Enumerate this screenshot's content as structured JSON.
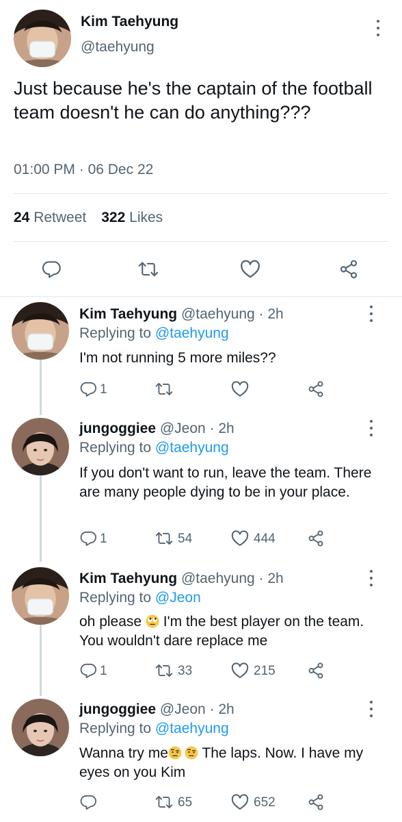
{
  "main_tweet": {
    "name": "Kim Taehyung",
    "handle": "@taehyung",
    "text": "Just because he's the captain of the football team doesn't he can do anything???",
    "time": "01:00 PM",
    "separator": "·",
    "date": "06 Dec 22",
    "retweets": "24",
    "retweets_label": "Retweet",
    "likes": "322",
    "likes_label": "Likes",
    "actions": [
      "reply-icon",
      "retweet-icon",
      "like-icon",
      "share-icon"
    ]
  },
  "replies": [
    {
      "name": "Kim Taehyung",
      "handle": "@taehyung",
      "age": "· 2h",
      "replying_prefix": "Replying to",
      "replying_to": "@taehyung",
      "text": "I'm not running 5 more miles??",
      "reply_count": "1",
      "retweet_count": "",
      "like_count": ""
    },
    {
      "name": "jungoggiee",
      "handle": "@Jeon",
      "age": "· 2h",
      "replying_prefix": "Replying to",
      "replying_to": "@taehyung",
      "text": "If you don't want to run, leave the team. There are many people dying to be in your place.",
      "reply_count": "1",
      "retweet_count": "54",
      "like_count": "444"
    },
    {
      "name": "Kim Taehyung",
      "handle": "@taehyung",
      "age": "· 2h",
      "replying_prefix": "Replying to",
      "replying_to": "@Jeon",
      "text_before_emoji": "oh please",
      "emoji": "rolling-eyes-emoji",
      "text_after_emoji": "I'm the best player on the team. You wouldn't dare replace me",
      "reply_count": "1",
      "retweet_count": "33",
      "like_count": "215"
    },
    {
      "name": "jungoggiee",
      "handle": "@Jeon",
      "age": "· 2h",
      "replying_prefix": "Replying to",
      "replying_to": "@taehyung",
      "text_before_emoji": "Wanna try me",
      "emoji": "raised-eyebrow-emoji",
      "text_after_emoji": "The laps. Now. I have my eyes on you Kim",
      "reply_count": "",
      "retweet_count": "65",
      "like_count": "652"
    }
  ],
  "colors": {
    "text": "#0f1419",
    "secondary": "#536471",
    "link": "#1d9bf0",
    "divider": "#e1e6ea"
  }
}
